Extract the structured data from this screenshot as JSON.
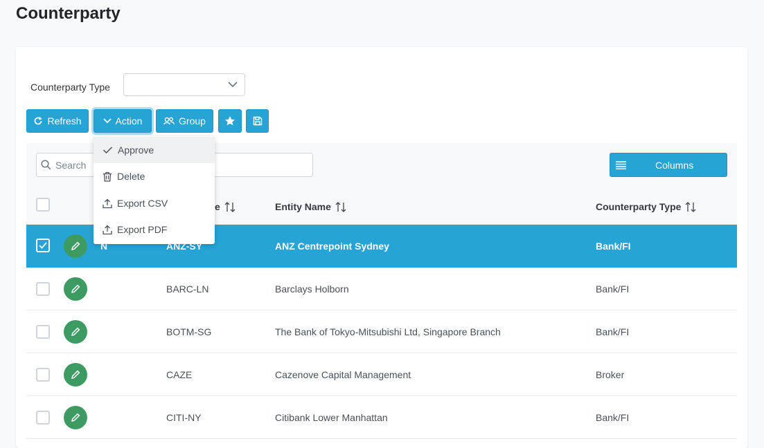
{
  "page": {
    "title": "Counterparty"
  },
  "filter": {
    "label": "Counterparty Type",
    "value": ""
  },
  "toolbar": {
    "refresh_label": "Refresh",
    "action_label": "Action",
    "group_label": "Group"
  },
  "search": {
    "placeholder": "Search"
  },
  "columns_button": {
    "label": "Columns"
  },
  "table": {
    "headers": {
      "code_tail": "e",
      "entity_name": "Entity Name",
      "counterparty_type": "Counterparty Type"
    },
    "rows": [
      {
        "code": "ANZ-SY",
        "entity_name": "ANZ Centrepoint Sydney",
        "type": "Bank/FI",
        "selected": true,
        "extra": "N"
      },
      {
        "code": "BARC-LN",
        "entity_name": "Barclays Holborn",
        "type": "Bank/FI"
      },
      {
        "code": "BOTM-SG",
        "entity_name": "The Bank of Tokyo-Mitsubishi Ltd, Singapore Branch",
        "type": "Bank/FI"
      },
      {
        "code": "CAZE",
        "entity_name": "Cazenove Capital Management",
        "type": "Broker"
      },
      {
        "code": "CITI-NY",
        "entity_name": "Citibank Lower Manhattan",
        "type": "Bank/FI"
      }
    ]
  },
  "action_menu": {
    "items": [
      {
        "label": "Approve",
        "icon": "check-icon"
      },
      {
        "label": "Delete",
        "icon": "trash-icon"
      },
      {
        "label": "Export CSV",
        "icon": "upload-icon"
      },
      {
        "label": "Export PDF",
        "icon": "upload-icon"
      }
    ]
  },
  "colors": {
    "primary": "#26a4d6",
    "edit_button": "#3d9b62",
    "selected_row": "#26a4d6"
  }
}
